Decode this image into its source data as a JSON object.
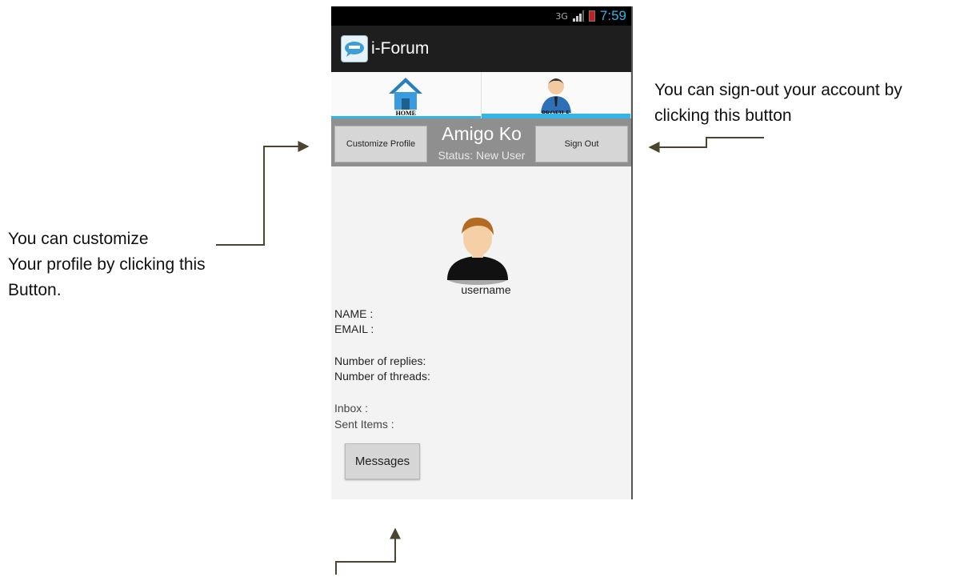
{
  "annotations": {
    "customize_lines": [
      "You can customize",
      "Your profile by clicking this",
      "Button."
    ],
    "signout_lines": [
      "You can sign-out your account by",
      "clicking this button"
    ]
  },
  "status_bar": {
    "signal": "3G",
    "time": "7:59"
  },
  "app": {
    "title": "i-Forum"
  },
  "tabs": [
    {
      "label": "HOME",
      "icon": "house-icon"
    },
    {
      "label": "PROFILE",
      "icon": "person-icon"
    }
  ],
  "profile_header": {
    "customize_label": "Customize Profile",
    "name": "Amigo Ko",
    "status": "Status: New User",
    "signout_label": "Sign Out"
  },
  "profile": {
    "username": "username",
    "name_label": "NAME :",
    "email_label": "EMAIL :",
    "replies_label": "Number of replies:",
    "threads_label": "Number of threads:",
    "inbox_label": "Inbox :",
    "sent_label": "Sent Items :",
    "messages_button": "Messages"
  },
  "colors": {
    "accent": "#33b5e5",
    "action_bar": "#1e1e1e",
    "profile_bar": "#8f8f8f",
    "arrow": "#4a4530"
  }
}
